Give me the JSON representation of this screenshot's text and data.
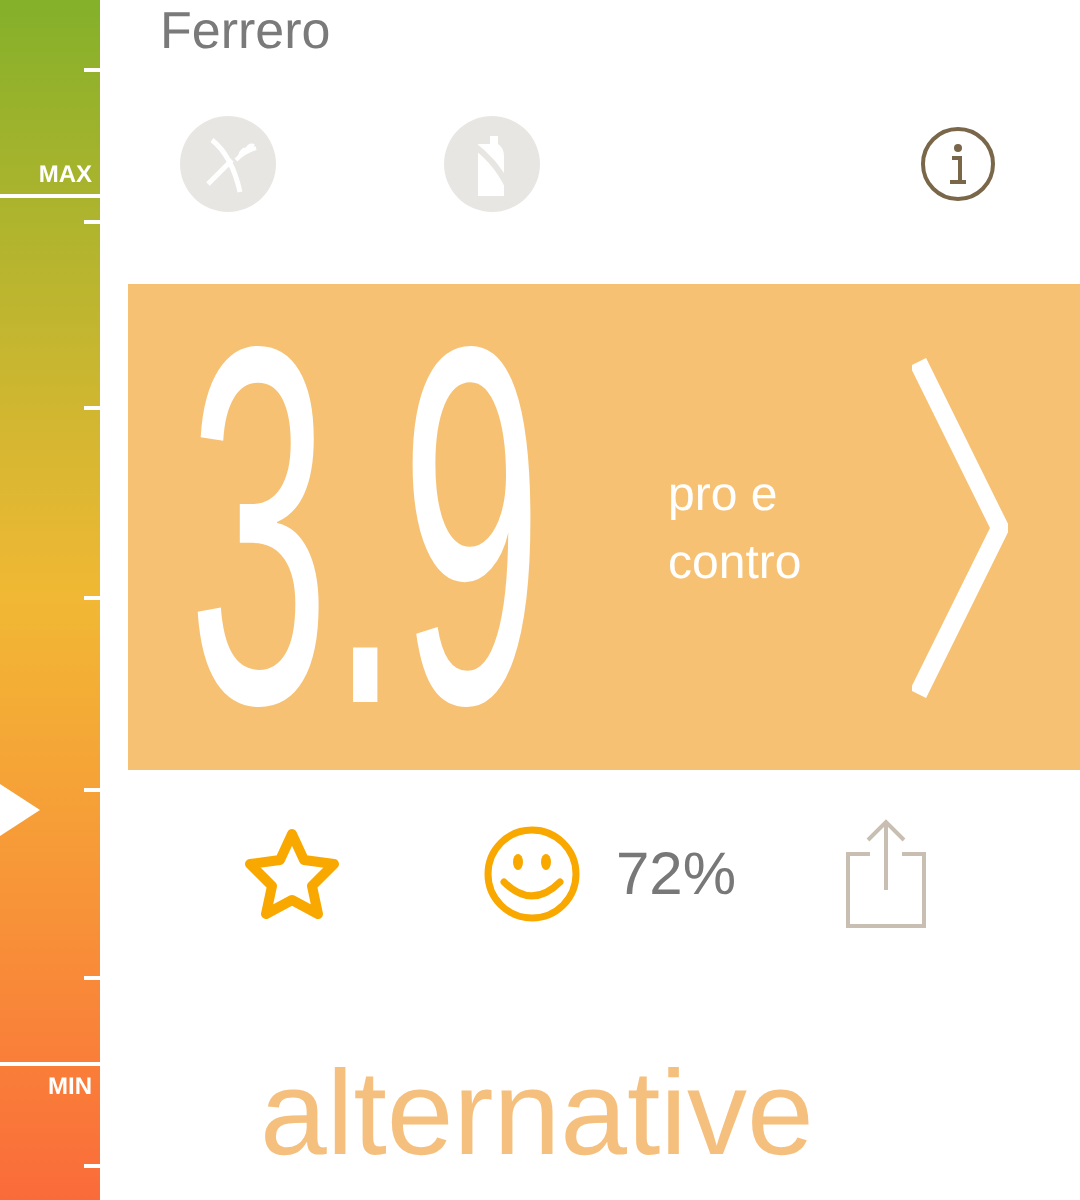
{
  "gauge": {
    "max_label": "MAX",
    "min_label": "MIN",
    "level": 0.29
  },
  "product": {
    "brand": "Ferrero"
  },
  "score": {
    "value": "3.9",
    "link": "pro e contro"
  },
  "rating": {
    "approval": "72%"
  },
  "section_title": "alternative"
}
